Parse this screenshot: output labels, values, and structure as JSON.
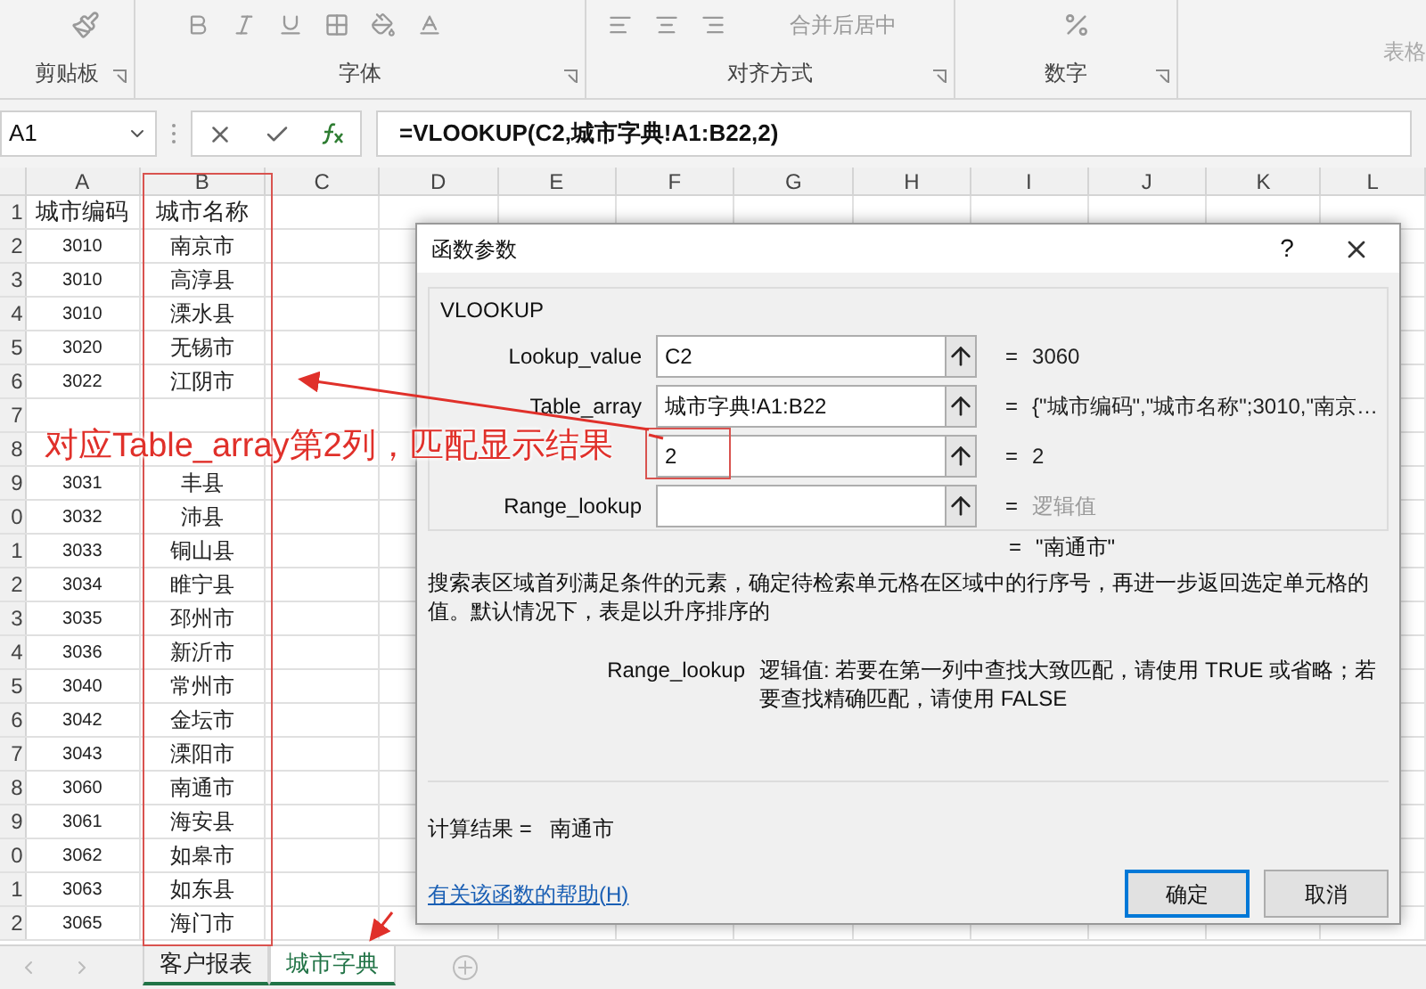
{
  "ribbon": {
    "merge_button": "合并后居中",
    "cut_label": "表格",
    "groups": [
      {
        "label": "剪贴板"
      },
      {
        "label": "字体"
      },
      {
        "label": "对齐方式"
      },
      {
        "label": "数字"
      }
    ]
  },
  "formula_bar": {
    "name_box": "A1",
    "formula": "=VLOOKUP(C2,城市字典!A1:B22,2)"
  },
  "sheet": {
    "columns": [
      "A",
      "B",
      "C",
      "D",
      "E",
      "F",
      "G",
      "H",
      "I",
      "J",
      "K",
      "L"
    ],
    "rows": [
      {
        "num": "1",
        "cells": [
          "城市编码",
          "城市名称"
        ],
        "kind": "header"
      },
      {
        "num": "2",
        "cells": [
          "3010",
          "南京市"
        ],
        "kind": "data"
      },
      {
        "num": "3",
        "cells": [
          "3010",
          "高淳县"
        ],
        "kind": "data"
      },
      {
        "num": "4",
        "cells": [
          "3010",
          "溧水县"
        ],
        "kind": "data"
      },
      {
        "num": "5",
        "cells": [
          "3020",
          "无锡市"
        ],
        "kind": "data"
      },
      {
        "num": "6",
        "cells": [
          "3022",
          "江阴市"
        ],
        "kind": "data"
      },
      {
        "num": "7",
        "cells": [],
        "kind": "data"
      },
      {
        "num": "8",
        "cells": [],
        "kind": "data"
      },
      {
        "num": "9",
        "cells": [
          "3031",
          "丰县"
        ],
        "kind": "data"
      },
      {
        "num": "0",
        "cells": [
          "3032",
          "沛县"
        ],
        "kind": "data"
      },
      {
        "num": "1",
        "cells": [
          "3033",
          "铜山县"
        ],
        "kind": "data"
      },
      {
        "num": "2",
        "cells": [
          "3034",
          "睢宁县"
        ],
        "kind": "data"
      },
      {
        "num": "3",
        "cells": [
          "3035",
          "邳州市"
        ],
        "kind": "data"
      },
      {
        "num": "4",
        "cells": [
          "3036",
          "新沂市"
        ],
        "kind": "data"
      },
      {
        "num": "5",
        "cells": [
          "3040",
          "常州市"
        ],
        "kind": "data"
      },
      {
        "num": "6",
        "cells": [
          "3042",
          "金坛市"
        ],
        "kind": "data"
      },
      {
        "num": "7",
        "cells": [
          "3043",
          "溧阳市"
        ],
        "kind": "data"
      },
      {
        "num": "8",
        "cells": [
          "3060",
          "南通市"
        ],
        "kind": "data"
      },
      {
        "num": "9",
        "cells": [
          "3061",
          "海安县"
        ],
        "kind": "data"
      },
      {
        "num": "0",
        "cells": [
          "3062",
          "如皋市"
        ],
        "kind": "data"
      },
      {
        "num": "1",
        "cells": [
          "3063",
          "如东县"
        ],
        "kind": "data"
      },
      {
        "num": "2",
        "cells": [
          "3065",
          "海门市"
        ],
        "kind": "data"
      }
    ]
  },
  "sheet_tabs": [
    {
      "label": "客户报表",
      "selected": false
    },
    {
      "label": "城市字典",
      "selected": true
    }
  ],
  "dialog": {
    "title": "函数参数",
    "help_glyph": "?",
    "function_name": "VLOOKUP",
    "args": [
      {
        "label": "Lookup_value",
        "value": "C2",
        "result": "3060",
        "greyed": false
      },
      {
        "label": "Table_array",
        "value": "城市字典!A1:B22",
        "result": "{\"城市编码\",\"城市名称\";3010,\"南京…",
        "greyed": false
      },
      {
        "value": "2",
        "result": "2",
        "greyed": false
      },
      {
        "label": "Range_lookup",
        "result": "逻辑值",
        "greyed": true
      }
    ],
    "equals": "=",
    "overall_result": "\"南通市\"",
    "description": "搜索表区域首列满足条件的元素，确定待检索单元格在区域中的行序号，再进一步返回选定单元格的值。默认情况下，表是以升序排序的",
    "arg_help_name": "Range_lookup",
    "arg_help": "逻辑值: 若要在第一列中查找大致匹配，请使用 TRUE 或省略；若要查找精确匹配，请使用 FALSE",
    "calc_label": "计算结果 =",
    "calc_value": "南通市",
    "help_link": "有关该函数的帮助(H)",
    "buttons": [
      {
        "label": "确定",
        "default": true
      },
      {
        "label": "取消",
        "default": false
      }
    ]
  },
  "annotation": {
    "text": "对应Table_array第2列，匹配显示结果"
  }
}
